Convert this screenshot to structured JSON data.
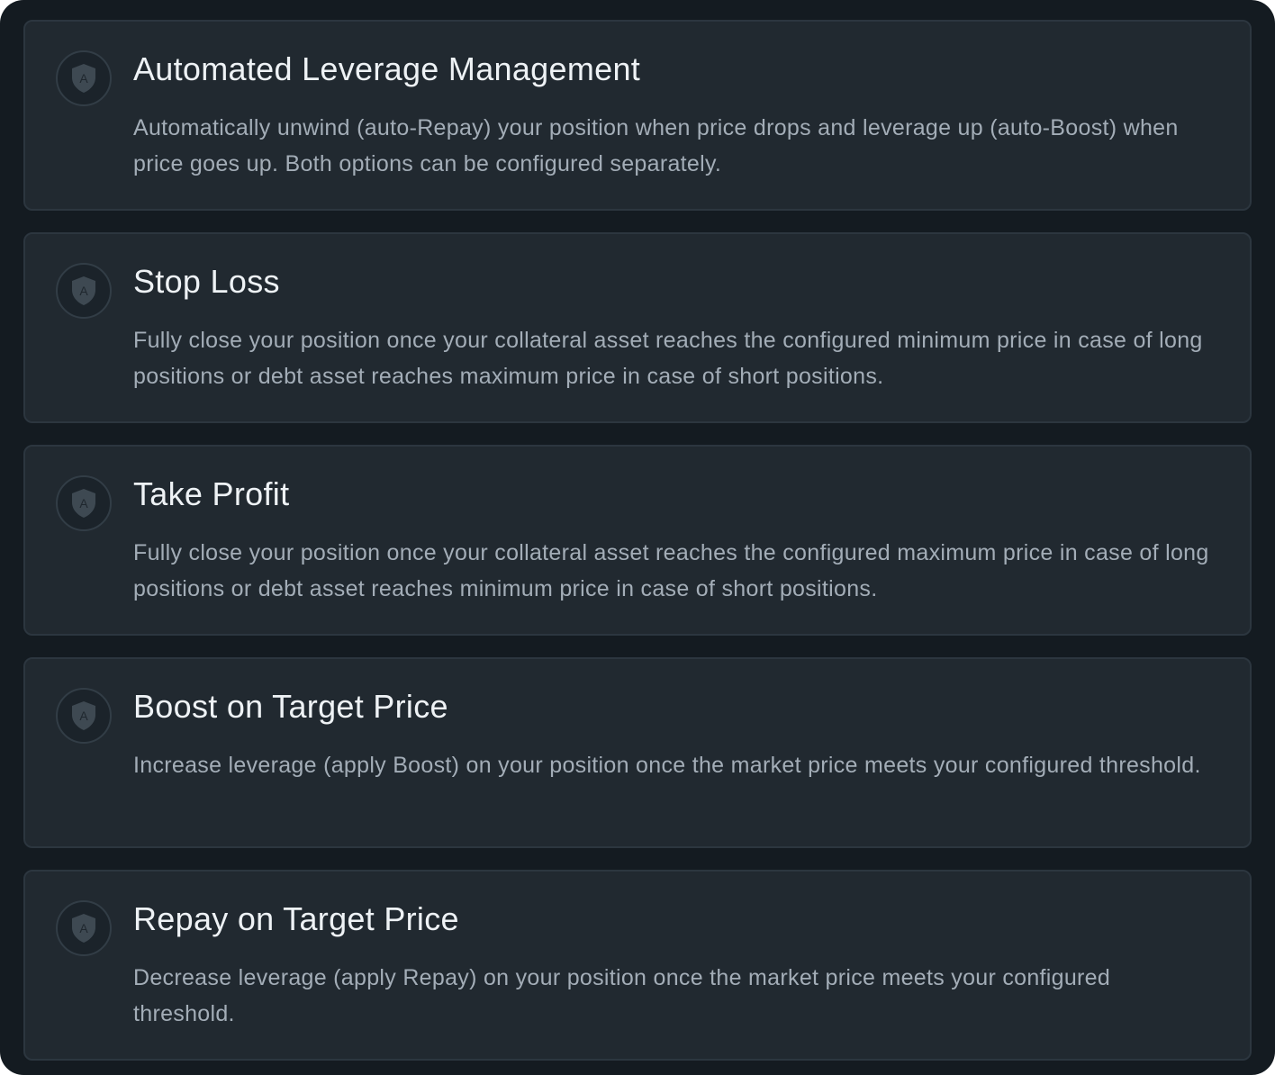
{
  "colors": {
    "panel_background": "#141b21",
    "card_background": "#212930",
    "card_border": "#2c363f",
    "title_text": "#eef2f5",
    "description_text": "#a3adb7",
    "icon_fill": "#3e4952",
    "icon_letter": "#1f272e"
  },
  "features": [
    {
      "icon": "shield-automation-icon",
      "icon_letter": "A",
      "title": "Automated Leverage Management",
      "description": "Automatically unwind (auto-Repay) your position when price drops and leverage up (auto-Boost) when price goes up. Both options can be configured separately."
    },
    {
      "icon": "shield-automation-icon",
      "icon_letter": "A",
      "title": "Stop Loss",
      "description": "Fully close your position once your collateral asset reaches the configured minimum price in case of long positions or debt asset reaches maximum price in case of short positions."
    },
    {
      "icon": "shield-automation-icon",
      "icon_letter": "A",
      "title": "Take Profit",
      "description": "Fully close your position once your collateral asset reaches the configured maximum price in case of long positions or debt asset reaches minimum price in case of short positions."
    },
    {
      "icon": "shield-automation-icon",
      "icon_letter": "A",
      "title": "Boost on Target Price",
      "description": "Increase leverage (apply Boost) on your position once the market price meets your configured threshold."
    },
    {
      "icon": "shield-automation-icon",
      "icon_letter": "A",
      "title": "Repay on Target Price",
      "description": "Decrease leverage (apply Repay) on your position once the market price meets your configured threshold."
    }
  ]
}
